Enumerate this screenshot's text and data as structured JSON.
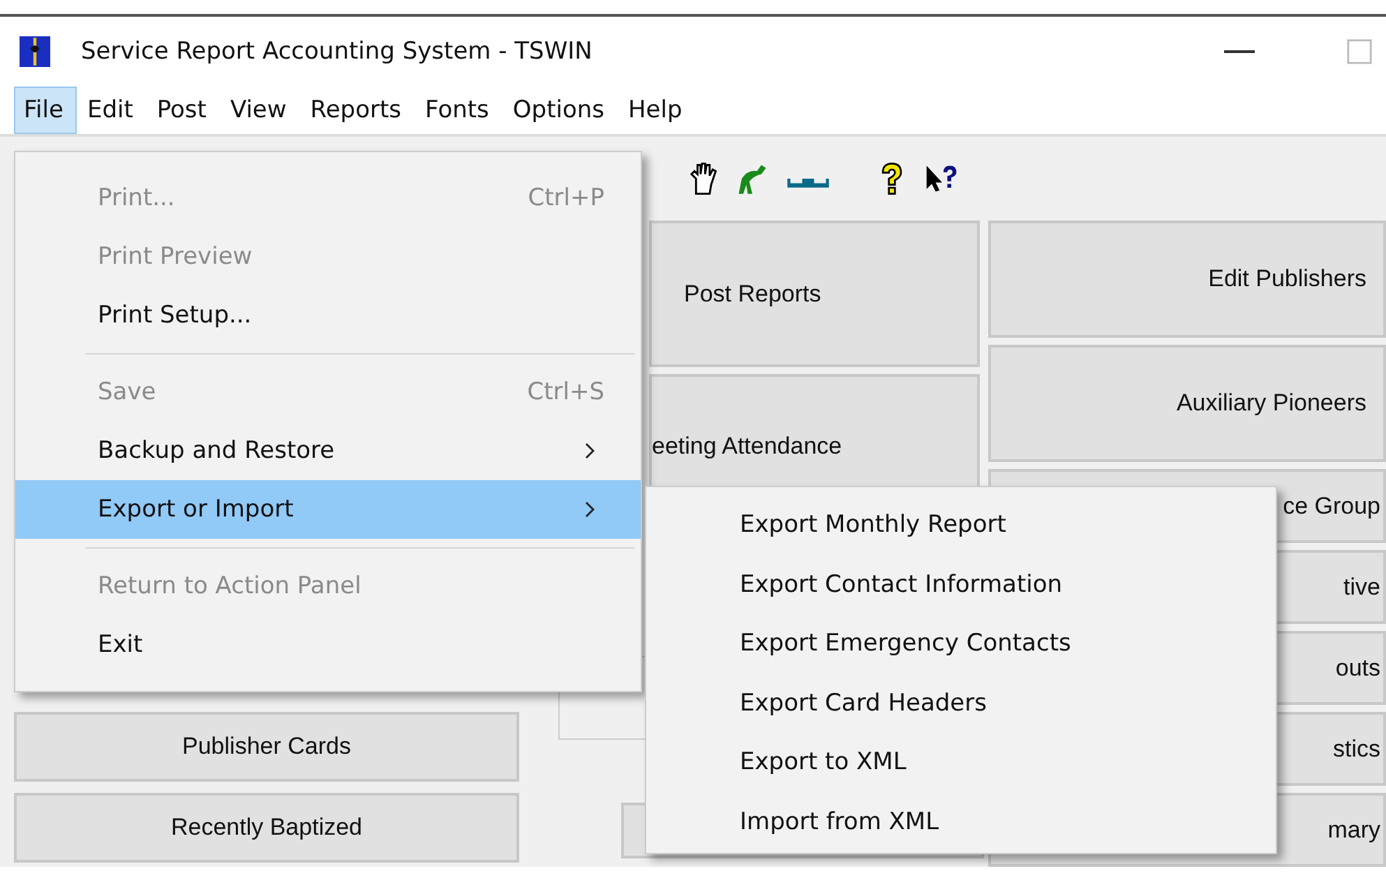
{
  "window": {
    "title": "Service Report Accounting System - TSWIN"
  },
  "menu_bar": [
    {
      "label": "File",
      "selected": true
    },
    {
      "label": "Edit",
      "selected": false
    },
    {
      "label": "Post",
      "selected": false
    },
    {
      "label": "View",
      "selected": false
    },
    {
      "label": "Reports",
      "selected": false
    },
    {
      "label": "Fonts",
      "selected": false
    },
    {
      "label": "Options",
      "selected": false
    },
    {
      "label": "Help",
      "selected": false
    }
  ],
  "file_menu": [
    {
      "kind": "item",
      "label": "Print...",
      "shortcut": "Ctrl+P",
      "disabled": true,
      "submenu": false,
      "selected": false
    },
    {
      "kind": "item",
      "label": "Print Preview",
      "disabled": true,
      "submenu": false,
      "selected": false
    },
    {
      "kind": "item",
      "label": "Print Setup...",
      "disabled": false,
      "submenu": false,
      "selected": false
    },
    {
      "kind": "separator"
    },
    {
      "kind": "item",
      "label": "Save",
      "shortcut": "Ctrl+S",
      "disabled": true,
      "submenu": false,
      "selected": false
    },
    {
      "kind": "item",
      "label": "Backup and Restore",
      "disabled": false,
      "submenu": true,
      "selected": false
    },
    {
      "kind": "item",
      "label": "Export or Import",
      "disabled": false,
      "submenu": true,
      "selected": true
    },
    {
      "kind": "separator"
    },
    {
      "kind": "item",
      "label": "Return to Action Panel",
      "disabled": true,
      "submenu": false,
      "selected": false
    },
    {
      "kind": "item",
      "label": "Exit",
      "disabled": false,
      "submenu": false,
      "selected": false
    }
  ],
  "export_submenu": [
    "Export Monthly Report",
    "Export Contact Information",
    "Export Emergency Contacts",
    "Export Card Headers",
    "Export to XML",
    "Import from XML"
  ],
  "panel": {
    "left_buttons": [
      "Publisher Cards",
      "Recently Baptized"
    ],
    "middle_buttons": [
      "Post Reports",
      "eeting Attendance"
    ],
    "right_buttons": [
      "Edit Publishers",
      "Auxiliary Pioneers",
      "ce Group",
      "tive",
      "outs",
      "stics",
      "mary"
    ]
  }
}
